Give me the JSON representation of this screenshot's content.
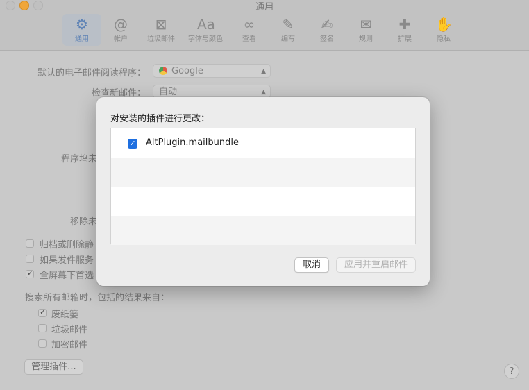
{
  "window": {
    "title": "通用"
  },
  "toolbar": {
    "items": [
      {
        "label": "通用",
        "icon": "gear-icon",
        "glyph": "⚙",
        "active": true
      },
      {
        "label": "帐户",
        "icon": "at-icon",
        "glyph": "@"
      },
      {
        "label": "垃圾邮件",
        "icon": "junk-icon",
        "glyph": "⊠"
      },
      {
        "label": "字体与颜色",
        "icon": "fonts-icon",
        "glyph": "Aa"
      },
      {
        "label": "查看",
        "icon": "glasses-icon",
        "glyph": "∞"
      },
      {
        "label": "编写",
        "icon": "compose-icon",
        "glyph": "✎"
      },
      {
        "label": "签名",
        "icon": "signature-icon",
        "glyph": "✍"
      },
      {
        "label": "规则",
        "icon": "rules-icon",
        "glyph": "✉"
      },
      {
        "label": "扩展",
        "icon": "puzzle-icon",
        "glyph": "✚"
      },
      {
        "label": "隐私",
        "icon": "hand-icon",
        "glyph": "✋"
      }
    ]
  },
  "general": {
    "default_reader_label": "默认的电子邮件阅读程序：",
    "default_reader_value": "Google",
    "check_mail_label": "检查新邮件：",
    "check_mail_value": "自动",
    "dock_label_partial": "程序坞未",
    "remove_label_partial": "移除未",
    "archive_label_partial": "归档或删除静",
    "server_label_partial": "如果发件服务",
    "fullscreen_label_partial": "全屏幕下首选",
    "search_heading": "搜索所有邮箱时，包括的结果来自：",
    "search_options": [
      {
        "label": "废纸篓",
        "checked": true
      },
      {
        "label": "垃圾邮件",
        "checked": false
      },
      {
        "label": "加密邮件",
        "checked": false
      }
    ],
    "manage_plugins_label": "管理插件...",
    "help_label": "?"
  },
  "sheet": {
    "title": "对安装的插件进行更改：",
    "plugins": [
      {
        "name": "AltPlugin.mailbundle",
        "checked": true
      }
    ],
    "cancel_label": "取消",
    "apply_label": "应用并重启邮件"
  },
  "colors": {
    "accent": "#1e6fe0",
    "sheet_bg": "#ececec",
    "dimmed_bg": "#c9c9c9",
    "minimize_button": "#f0a63a"
  }
}
